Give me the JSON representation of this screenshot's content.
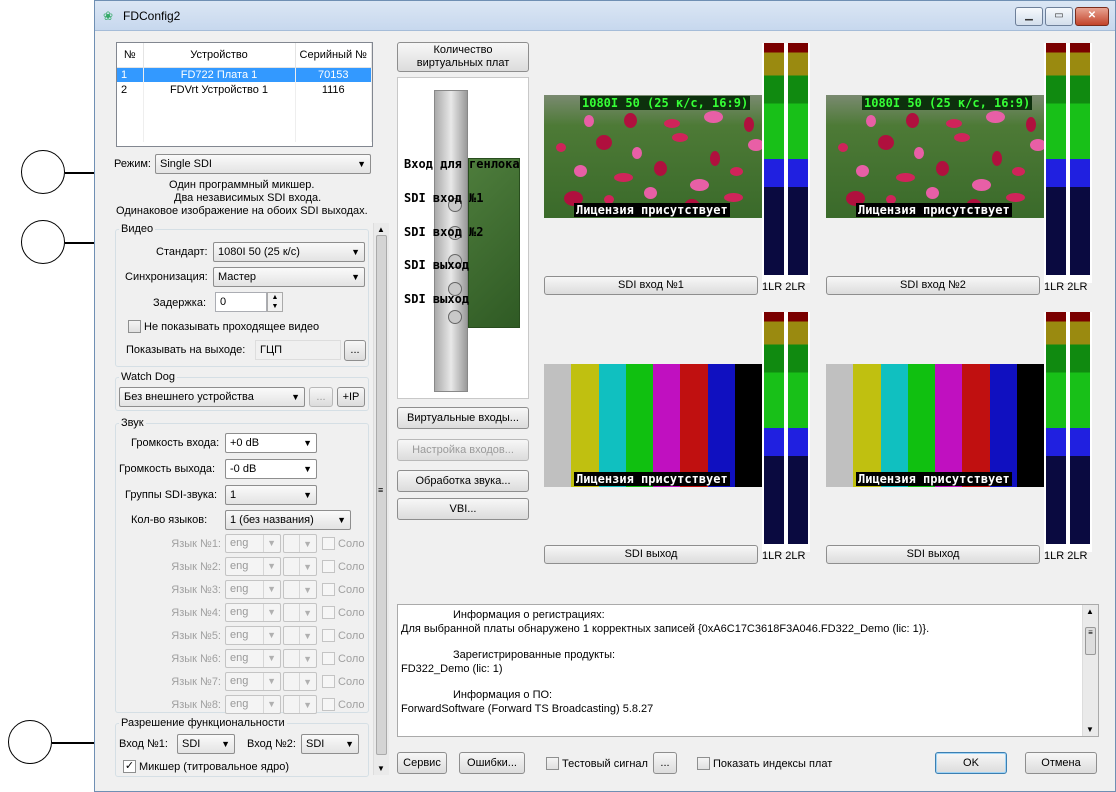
{
  "window": {
    "title": "FDConfig2"
  },
  "device_table": {
    "headers": [
      "№",
      "Устройство",
      "Серийный №"
    ],
    "rows": [
      {
        "num": "1",
        "device": "FD722 Плата 1",
        "serial": "70153",
        "selected": true
      },
      {
        "num": "2",
        "device": "FDVrt Устройство 1",
        "serial": "1116",
        "selected": false
      }
    ]
  },
  "mode": {
    "label": "Режим:",
    "value": "Single SDI",
    "description": [
      "Один программный микшер.",
      "Два независимых SDI входа.",
      "Одинаковое изображение на обоих SDI выходах."
    ]
  },
  "video": {
    "group_title": "Видео",
    "standard_label": "Стандарт:",
    "standard_value": "1080I 50 (25 к/с)",
    "sync_label": "Синхронизация:",
    "sync_value": "Мастер",
    "delay_label": "Задержка:",
    "delay_value": "0",
    "hide_passthrough_label": "Не показывать проходящее видео",
    "show_output_label": "Показывать на выходе:",
    "show_output_value": "ГЦП",
    "browse": "..."
  },
  "watchdog": {
    "group_title": "Watch Dog",
    "value": "Без внешнего устройства",
    "dots": "...",
    "ip": "+IP"
  },
  "sound": {
    "group_title": "Звук",
    "input_vol_label": "Громкость входа:",
    "input_vol_value": "+0 dB",
    "output_vol_label": "Громкость выхода:",
    "output_vol_value": "-0 dB",
    "groups_label": "Группы SDI-звука:",
    "groups_value": "1",
    "langs_label": "Кол-во языков:",
    "langs_value": "1 (без названия)",
    "languages": [
      {
        "label": "Язык №1:",
        "value": "eng",
        "solo": "Соло"
      },
      {
        "label": "Язык №2:",
        "value": "eng",
        "solo": "Соло"
      },
      {
        "label": "Язык №3:",
        "value": "eng",
        "solo": "Соло"
      },
      {
        "label": "Язык №4:",
        "value": "eng",
        "solo": "Соло"
      },
      {
        "label": "Язык №5:",
        "value": "eng",
        "solo": "Соло"
      },
      {
        "label": "Язык №6:",
        "value": "eng",
        "solo": "Соло"
      },
      {
        "label": "Язык №7:",
        "value": "eng",
        "solo": "Соло"
      },
      {
        "label": "Язык №8:",
        "value": "eng",
        "solo": "Соло"
      }
    ]
  },
  "functionality": {
    "group_title": "Разрешение функциональности",
    "input1_label": "Вход №1:",
    "input1_value": "SDI",
    "input2_label": "Вход №2:",
    "input2_value": "SDI",
    "mixer_label": "Микшер (титровальное ядро)"
  },
  "card": {
    "virtual_count_button": [
      "Количество",
      "виртуальных плат"
    ],
    "labels": [
      "Вход для генлока",
      "SDI вход №1",
      "SDI вход №2",
      "SDI выход",
      "SDI выход"
    ]
  },
  "middle_buttons": {
    "virtual_inputs": "Виртуальные входы...",
    "input_settings": "Настройка входов...",
    "audio_processing": "Обработка звука...",
    "vbi": "VBI..."
  },
  "previews": [
    {
      "format": "1080I 50 (25 к/с, 16:9)",
      "license": "Лицензия присутствует",
      "button": "SDI вход №1",
      "meter_label": "1LR 2LR",
      "kind": "flowers"
    },
    {
      "format": "1080I 50 (25 к/с, 16:9)",
      "license": "Лицензия присутствует",
      "button": "SDI вход №2",
      "meter_label": "1LR 2LR",
      "kind": "flowers"
    },
    {
      "format": "",
      "license": "Лицензия присутствует",
      "button": "SDI выход",
      "meter_label": "1LR 2LR",
      "kind": "bars"
    },
    {
      "format": "",
      "license": "Лицензия присутствует",
      "button": "SDI выход",
      "meter_label": "1LR 2LR",
      "kind": "bars"
    }
  ],
  "info": {
    "lines": [
      {
        "text": "Информация о регистрациях:",
        "indent": true
      },
      {
        "text": "Для выбранной платы обнаружено 1 корректных записей {0xA6C17C3618F3A046.FD322_Demo (lic: 1)}.",
        "indent": false
      },
      {
        "text": "",
        "indent": false
      },
      {
        "text": "Зарегистрированные продукты:",
        "indent": true
      },
      {
        "text": "FD322_Demo (lic: 1)",
        "indent": false
      },
      {
        "text": "",
        "indent": false
      },
      {
        "text": "Информация о ПО:",
        "indent": true
      },
      {
        "text": "ForwardSoftware (Forward TS Broadcasting) 5.8.27",
        "indent": false
      }
    ]
  },
  "bottom": {
    "service": "Сервис",
    "errors": "Ошибки...",
    "test_signal": "Тестовый сигнал",
    "test_dots": "...",
    "show_indexes": "Показать индексы плат",
    "ok": "OK",
    "cancel": "Отмена"
  },
  "colors": {
    "selection": "#3399ff",
    "bars": [
      "#c0c0c0",
      "#c0c010",
      "#10c0c0",
      "#10c010",
      "#c010c0",
      "#c01010",
      "#1010c0",
      "#000000"
    ]
  }
}
